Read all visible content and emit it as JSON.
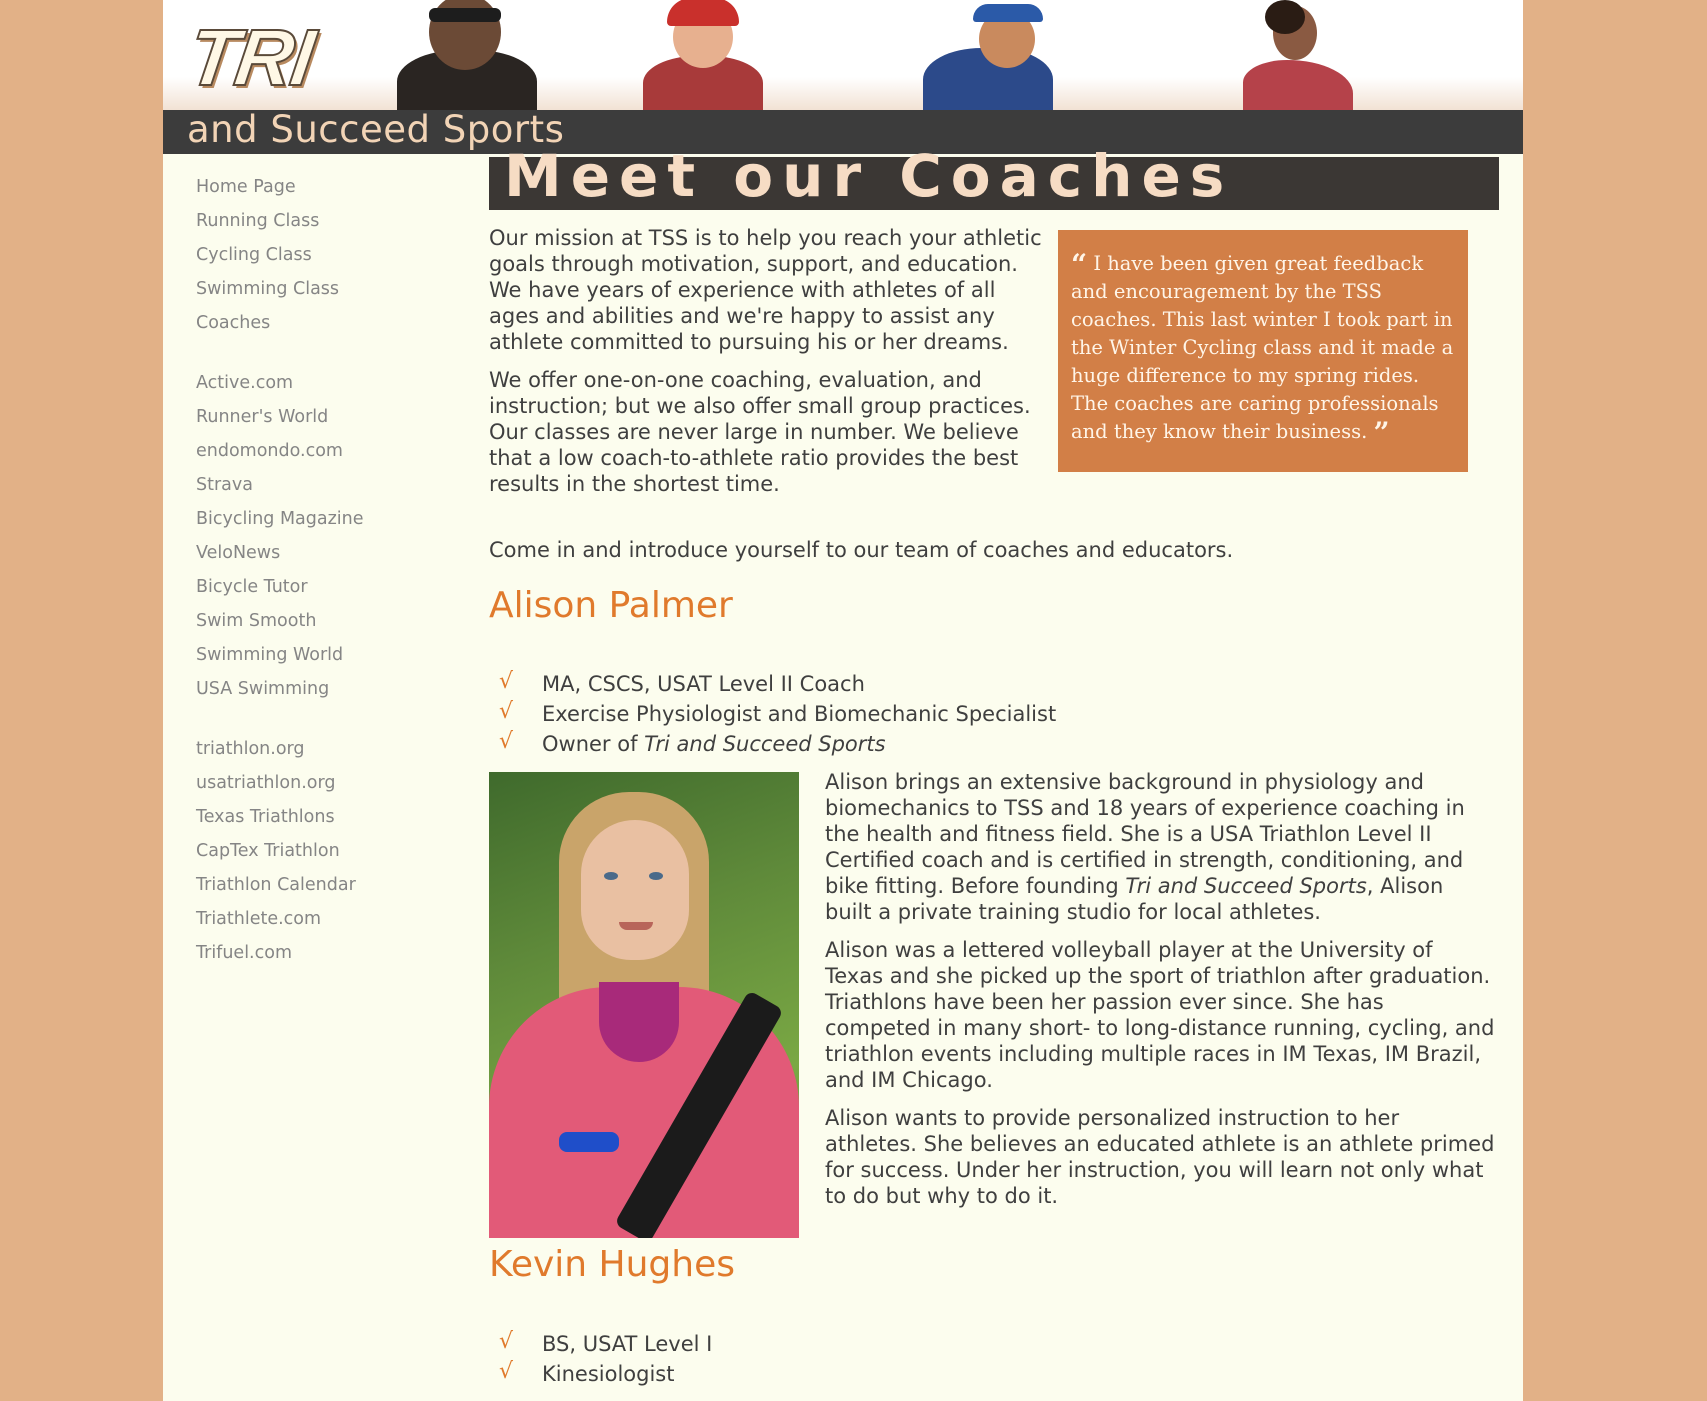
{
  "header": {
    "logo_main": "TRI",
    "logo_sub": "and Succeed Sports"
  },
  "sidebar": {
    "groups": [
      [
        "Home Page",
        "Running Class",
        "Cycling Class",
        "Swimming Class",
        "Coaches"
      ],
      [
        "Active.com",
        "Runner's World",
        "endomondo.com",
        "Strava",
        "Bicycling Magazine",
        "VeloNews",
        "Bicycle Tutor",
        "Swim Smooth",
        "Swimming World",
        "USA Swimming"
      ],
      [
        "triathlon.org",
        "usatriathlon.org",
        "Texas Triathlons",
        "CapTex Triathlon",
        "Triathlon Calendar",
        "Triathlete.com",
        "Trifuel.com"
      ]
    ]
  },
  "main": {
    "title": "Meet our Coaches",
    "intro_p1": "Our mission at TSS is to help you reach your athletic goals through motivation, support, and education. We have years of experience with athletes of all ages and abilities and we're happy to assist any athlete committed to pursuing his or her dreams.",
    "intro_p2": "We offer one-on-one coaching, evaluation, and instruction; but we also offer small group practices. Our classes are never large in number. We believe that a low coach-to-athlete ratio provides the best results in the shortest time.",
    "intro_p3": "Come in and introduce yourself to our team of coaches and educators.",
    "quote": {
      "open_mark": "“",
      "text": "I have been given great feedback and encouragement by the TSS coaches. This last winter I took part in the Winter Cycling class and it made a huge difference to my spring rides. The coaches are caring professionals and they know their business.",
      "close_mark": "”"
    },
    "check_glyph": "√",
    "coaches": [
      {
        "name": "Alison Palmer",
        "credentials": [
          "MA, CSCS, USAT Level II Coach",
          "Exercise Physiologist and Biomechanic Specialist"
        ],
        "owner_prefix": "Owner of ",
        "owner_company": "Tri and Succeed Sports",
        "bio1_a": "Alison brings an extensive background in physiology and biomechanics to TSS and 18 years of experience coaching in the health and fitness field. She is a USA Triathlon Level II Certified coach and is certified in strength, conditioning, and bike fitting. Before founding ",
        "bio1_company": "Tri and Succeed Sports",
        "bio1_b": ", Alison built a private training studio for local athletes.",
        "bio2": "Alison was a lettered volleyball player at the University of Texas and she picked up the sport of triathlon after graduation. Triathlons have been her passion ever since. She has competed in many short- to long-distance running, cycling, and triathlon events including multiple races in IM Texas, IM Brazil, and IM Chicago.",
        "bio3": "Alison wants to provide personalized instruction to her athletes. She believes an educated athlete is an athlete primed for success. Under her instruction, you will learn not only what to do but why to do it."
      },
      {
        "name": "Kevin Hughes",
        "credentials": [
          "BS, USAT Level I",
          "Kinesiologist"
        ]
      }
    ]
  },
  "colors": {
    "page_bg": "#e2b187",
    "content_bg": "#fcfdee",
    "accent": "#e07a2c",
    "quote_bg": "#d27f47",
    "header_bar": "#3c3c3c"
  }
}
